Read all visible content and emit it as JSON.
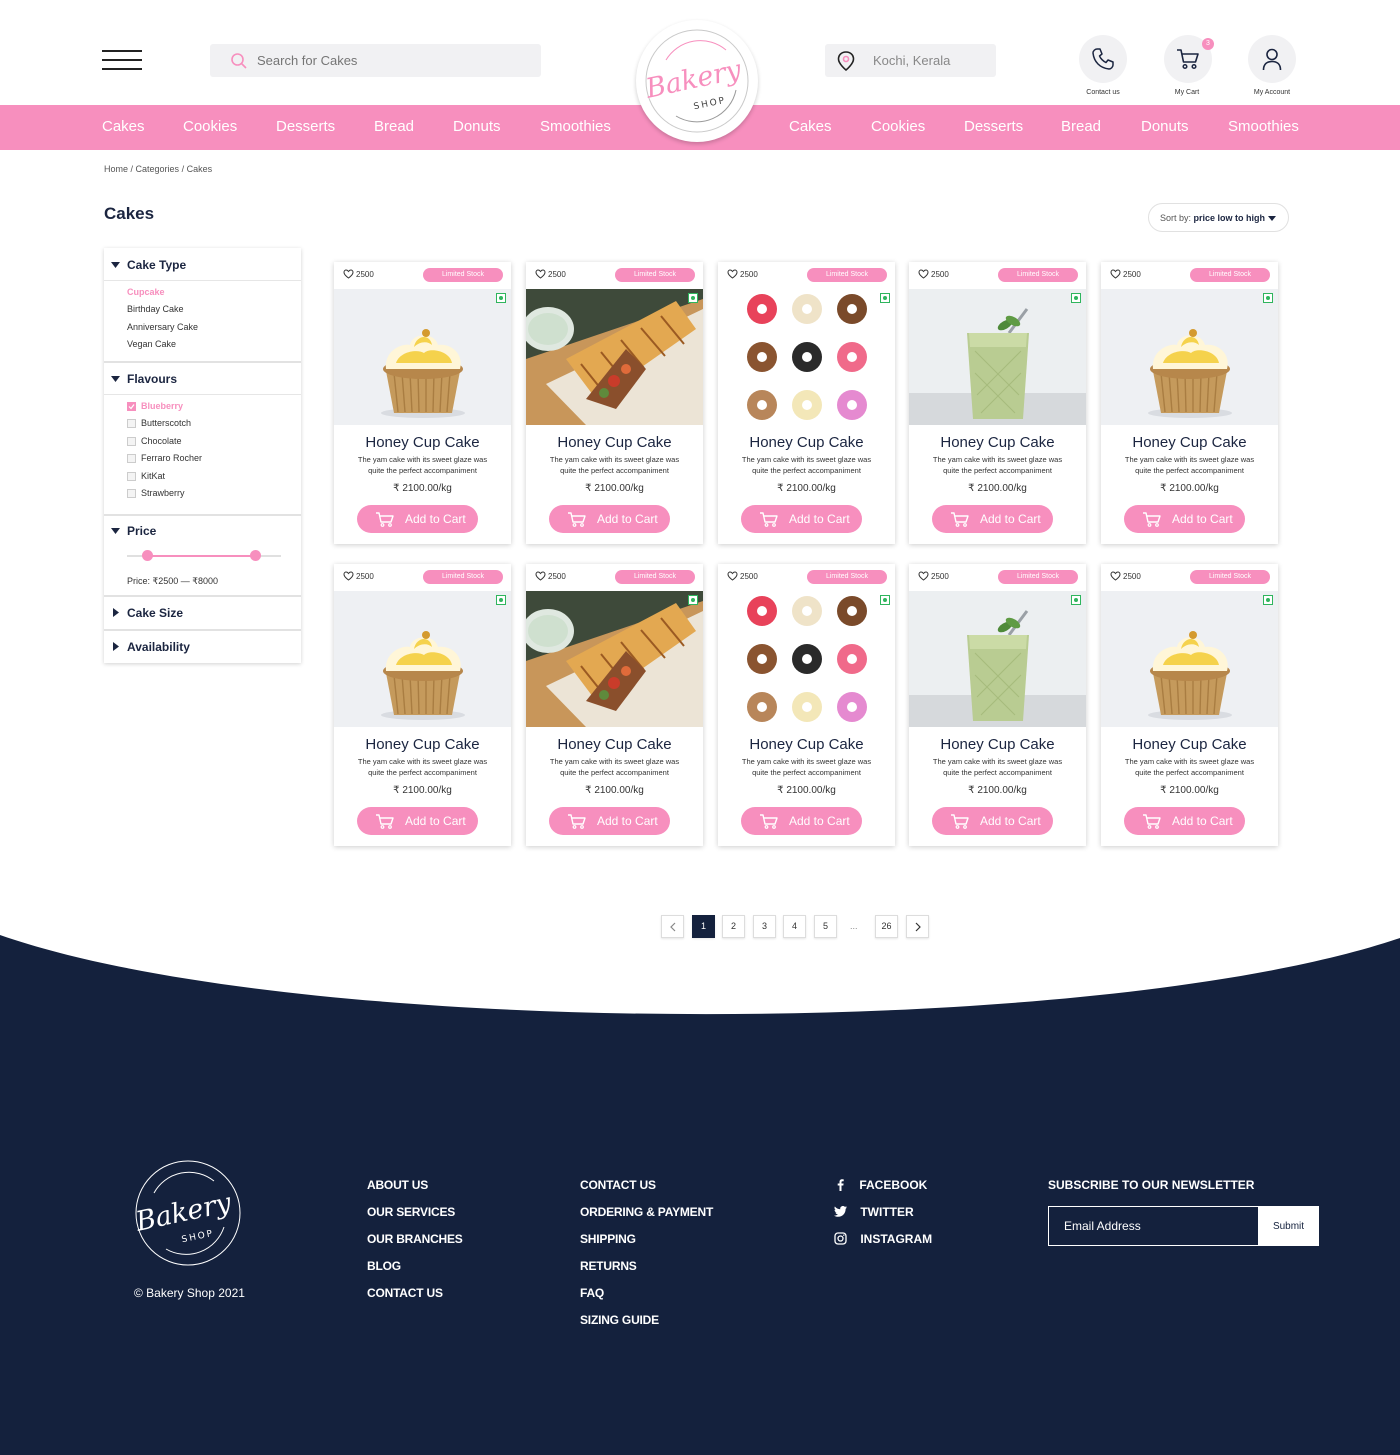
{
  "header": {
    "search_placeholder": "Search for Cakes",
    "location": "Kochi, Kerala",
    "contact_label": "Contact us",
    "cart_label": "My Cart",
    "cart_count": "3",
    "account_label": "My Account",
    "logo_text": "Bakery",
    "logo_sub": "SHOP"
  },
  "nav": {
    "left": [
      "Cakes",
      "Cookies",
      "Desserts",
      "Bread",
      "Donuts",
      "Smoothies"
    ],
    "right": [
      "Cakes",
      "Cookies",
      "Desserts",
      "Bread",
      "Donuts",
      "Smoothies"
    ]
  },
  "breadcrumb": {
    "home": "Home",
    "categories": "Categories",
    "current": "Cakes",
    "sep": " / "
  },
  "page_title": "Cakes",
  "sort": {
    "prefix": "Sort by: ",
    "value": "price low to high"
  },
  "filters": {
    "cake_type": {
      "title": "Cake Type",
      "items": [
        "Cupcake",
        "Birthday Cake",
        "Anniversary Cake",
        "Vegan Cake"
      ],
      "active": "Cupcake"
    },
    "flavours": {
      "title": "Flavours",
      "items": [
        "Blueberry",
        "Butterscotch",
        "Chocolate",
        "Ferraro Rocher",
        "KitKat",
        "Strawberry"
      ],
      "checked": "Blueberry"
    },
    "price": {
      "title": "Price",
      "text": "Price: ₹2500 — ₹8000"
    },
    "cake_size": {
      "title": "Cake Size"
    },
    "availability": {
      "title": "Availability"
    }
  },
  "product": {
    "likes": "2500",
    "stock": "Limited Stock",
    "name": "Honey Cup Cake",
    "desc": "The yam cake with its sweet glaze was quite the perfect accompaniment",
    "price": "₹ 2100.00/kg",
    "add_label": "Add to Cart"
  },
  "products": [
    "cupcake",
    "wrap",
    "donuts",
    "smoothie",
    "cupcake",
    "cupcake",
    "wrap",
    "donuts",
    "smoothie",
    "cupcake"
  ],
  "pagination": {
    "pages": [
      "1",
      "2",
      "3",
      "4",
      "5"
    ],
    "current": "1",
    "ellipsis": "...",
    "last": "26"
  },
  "footer": {
    "copyright": "© Bakery Shop 2021",
    "col1": [
      "ABOUT US",
      "OUR SERVICES",
      "OUR BRANCHES",
      "BLOG",
      "CONTACT US"
    ],
    "col2": [
      "CONTACT US",
      "ORDERING & PAYMENT",
      "SHIPPING",
      "RETURNS",
      "FAQ",
      "SIZING GUIDE"
    ],
    "social": [
      "FACEBOOK",
      "TWITTER",
      "INSTAGRAM"
    ],
    "newsletter_title": "SUBSCRIBE TO OUR NEWSLETTER",
    "email_placeholder": "Email Address",
    "submit_label": "Submit"
  },
  "colors": {
    "pink": "#f78fbe",
    "navy": "#14213d"
  }
}
